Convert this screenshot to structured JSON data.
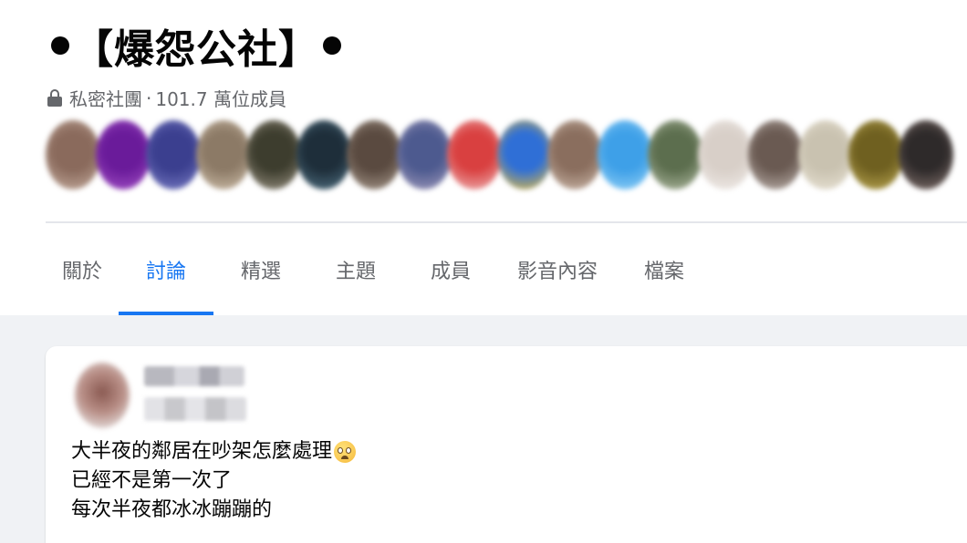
{
  "group": {
    "title": "【爆怨公社】",
    "privacy_label": "私密社團",
    "separator": "·",
    "member_count": "101.7 萬位成員"
  },
  "member_avatars": [
    {
      "colors": [
        "#8a6a5c",
        "#c9b1a3"
      ]
    },
    {
      "colors": [
        "#6a1b9a",
        "#a855c9"
      ]
    },
    {
      "colors": [
        "#3b3f8f",
        "#7f82c9"
      ]
    },
    {
      "colors": [
        "#8c7a66",
        "#d4c5b0"
      ]
    },
    {
      "colors": [
        "#3d3d2e",
        "#a29a8a"
      ]
    },
    {
      "colors": [
        "#1e2e3a",
        "#56788a"
      ]
    },
    {
      "colors": [
        "#5a4a40",
        "#b0a294"
      ]
    },
    {
      "colors": [
        "#4d5a8f",
        "#a8a0c0"
      ]
    },
    {
      "colors": [
        "#d94040",
        "#f0c0c0"
      ]
    },
    {
      "colors": [
        "#2f6fd6",
        "#f2c230"
      ]
    },
    {
      "colors": [
        "#8a6e5e",
        "#d3c0b1"
      ]
    },
    {
      "colors": [
        "#3ea0e8",
        "#9ad5f7"
      ]
    },
    {
      "colors": [
        "#5c6e4e",
        "#b9c2aa"
      ]
    },
    {
      "colors": [
        "#d8cfc8",
        "#f3efec"
      ]
    },
    {
      "colors": [
        "#6a5a52",
        "#c4bab4"
      ]
    },
    {
      "colors": [
        "#c9c2b0",
        "#ece6d8"
      ]
    },
    {
      "colors": [
        "#6f6020",
        "#c2ae56"
      ]
    },
    {
      "colors": [
        "#2e2a2a",
        "#8c7a74"
      ]
    }
  ],
  "tabs": [
    {
      "label": "關於",
      "active": false
    },
    {
      "label": "討論",
      "active": true
    },
    {
      "label": "精選",
      "active": false
    },
    {
      "label": "主題",
      "active": false
    },
    {
      "label": "成員",
      "active": false
    },
    {
      "label": "影音內容",
      "active": false
    },
    {
      "label": "檔案",
      "active": false
    }
  ],
  "post": {
    "lines": [
      "大半夜的鄰居在吵架怎麼處理",
      "已經不是第一次了",
      "每次半夜都冰冰蹦蹦的"
    ],
    "emoji": "face-with-rolling-eyes-icon"
  },
  "colors": {
    "accent": "#1877f2",
    "secondary_text": "#65676b",
    "background": "#f0f2f5",
    "card": "#ffffff"
  }
}
